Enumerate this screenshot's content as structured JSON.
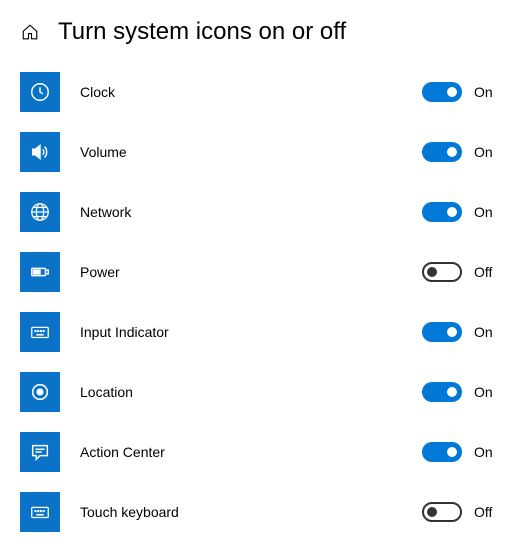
{
  "header": {
    "title": "Turn system icons on or off"
  },
  "labels": {
    "on": "On",
    "off": "Off"
  },
  "items": [
    {
      "id": "clock",
      "label": "Clock",
      "state": true,
      "icon": "clock-icon"
    },
    {
      "id": "volume",
      "label": "Volume",
      "state": true,
      "icon": "volume-icon"
    },
    {
      "id": "network",
      "label": "Network",
      "state": true,
      "icon": "network-icon"
    },
    {
      "id": "power",
      "label": "Power",
      "state": false,
      "icon": "power-icon"
    },
    {
      "id": "input-indicator",
      "label": "Input Indicator",
      "state": true,
      "icon": "keyboard-icon"
    },
    {
      "id": "location",
      "label": "Location",
      "state": true,
      "icon": "location-icon"
    },
    {
      "id": "action-center",
      "label": "Action Center",
      "state": true,
      "icon": "action-center-icon"
    },
    {
      "id": "touch-keyboard",
      "label": "Touch keyboard",
      "state": false,
      "icon": "keyboard-icon"
    }
  ]
}
